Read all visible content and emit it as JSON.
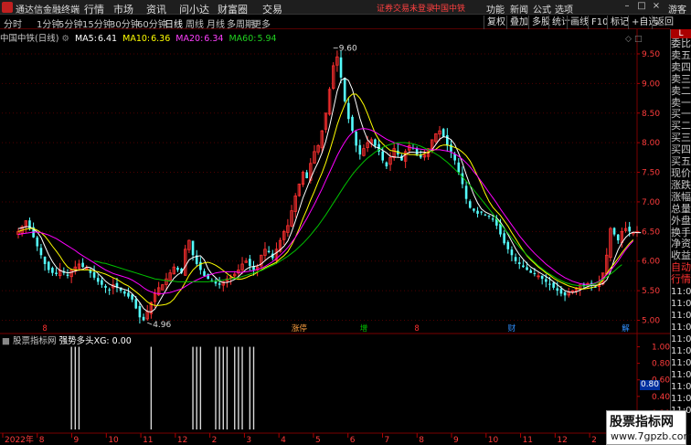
{
  "titlebar": {
    "app_title": "通达信金融终端",
    "menus": [
      "行情",
      "市场",
      "资讯",
      "问小达",
      "财富圈",
      "交易"
    ],
    "warning": "证券交易未登录",
    "stock_name": "中国中铁",
    "right_menus": [
      "功能",
      "新闻",
      "公式",
      "选项"
    ],
    "guest": "游客",
    "win_buttons": [
      "–",
      "□",
      "×"
    ]
  },
  "periods": {
    "items": [
      "分时",
      "1分钟",
      "5分钟",
      "15分钟",
      "30分钟",
      "60分钟",
      "日线",
      "周线",
      "月线",
      "多周期",
      "更多"
    ],
    "active": "日线"
  },
  "toolbar_right": [
    "复权",
    "叠加",
    "多股",
    "统计",
    "画线",
    "F10",
    "标记",
    "+自选",
    "返回"
  ],
  "main_header": {
    "stock": "中国中铁(日线)",
    "ma5_label": "MA5:",
    "ma5": "6.41",
    "ma10_label": "MA10:",
    "ma10": "6.36",
    "ma20_label": "MA20:",
    "ma20": "6.34",
    "ma60_label": "MA60:",
    "ma60": "5.94"
  },
  "colors": {
    "up": "#ff3030",
    "down": "#54fcfc",
    "ma5": "#ffffff",
    "ma10": "#ffff00",
    "ma20": "#ff00ff",
    "ma60": "#00c000",
    "grid": "#500000",
    "axis_text": "#ff3c3c"
  },
  "chart_data": [
    {
      "type": "candlestick",
      "title": "中国中铁(日线)",
      "ylim": [
        4.9,
        9.7
      ],
      "y_ticks": [
        "9.50",
        "9.00",
        "8.50",
        "8.00",
        "7.50",
        "7.00",
        "6.50",
        "6.00",
        "5.50",
        "5.00"
      ],
      "annotations": [
        {
          "label": "9.60",
          "x": 83,
          "y": 9.6
        },
        {
          "label": "4.96",
          "x": 34,
          "y": 4.96
        }
      ],
      "event_markers": [
        {
          "label": "8",
          "x": 7,
          "color": "#ff3030"
        },
        {
          "label": "涨停",
          "x": 74,
          "color": "#ffa040"
        },
        {
          "label": "增",
          "x": 91,
          "color": "#00c000"
        },
        {
          "label": "8",
          "x": 105,
          "color": "#ff3030"
        },
        {
          "label": "财",
          "x": 130,
          "color": "#3090ff"
        },
        {
          "label": "解",
          "x": 160,
          "color": "#3090ff"
        }
      ],
      "ma_last": {
        "MA5": 6.41,
        "MA10": 6.36,
        "MA20": 6.34,
        "MA60": 5.94
      },
      "series": [
        {
          "name": "close",
          "values": [
            6.5,
            6.58,
            6.68,
            6.55,
            6.4,
            6.25,
            6.1,
            5.95,
            5.85,
            5.8,
            5.78,
            5.85,
            5.8,
            5.75,
            5.85,
            5.9,
            5.95,
            5.9,
            5.88,
            5.8,
            5.72,
            5.65,
            5.6,
            5.55,
            5.52,
            5.6,
            5.55,
            5.5,
            5.45,
            5.4,
            5.35,
            5.2,
            5.05,
            5.0,
            5.15,
            5.3,
            5.45,
            5.55,
            5.6,
            5.7,
            5.8,
            5.9,
            5.85,
            5.8,
            6.2,
            6.35,
            6.1,
            5.95,
            5.85,
            5.75,
            5.7,
            5.65,
            5.62,
            5.6,
            5.65,
            5.7,
            5.72,
            5.78,
            5.85,
            5.95,
            6.0,
            5.92,
            5.85,
            5.9,
            6.1,
            6.2,
            6.15,
            6.05,
            6.2,
            6.35,
            6.5,
            6.6,
            6.85,
            7.1,
            7.3,
            7.5,
            7.4,
            7.65,
            7.85,
            7.95,
            8.2,
            8.5,
            8.9,
            9.3,
            9.45,
            9.1,
            8.7,
            8.4,
            8.2,
            7.95,
            7.8,
            7.9,
            8.0,
            8.05,
            7.95,
            7.85,
            7.7,
            7.6,
            7.75,
            7.9,
            7.8,
            7.7,
            7.85,
            7.95,
            7.9,
            7.8,
            7.75,
            7.8,
            7.9,
            8.05,
            8.15,
            8.2,
            8.1,
            7.95,
            7.85,
            7.7,
            7.5,
            7.3,
            7.05,
            6.9,
            6.85,
            6.8,
            6.82,
            6.78,
            6.75,
            6.7,
            6.6,
            6.45,
            6.3,
            6.2,
            6.1,
            6.0,
            5.95,
            5.9,
            5.85,
            5.8,
            5.78,
            5.75,
            5.7,
            5.65,
            5.6,
            5.55,
            5.5,
            5.45,
            5.42,
            5.48,
            5.5,
            5.55,
            5.6,
            5.58,
            5.62,
            5.6,
            5.55,
            5.65,
            5.8,
            6.1,
            6.55,
            6.45,
            6.35,
            6.5,
            6.55,
            6.5,
            6.48,
            6.5
          ]
        },
        {
          "name": "MA5",
          "values": [
            6.55,
            6.56,
            6.58,
            6.58,
            6.54,
            6.49,
            6.4,
            6.25,
            6.11,
            5.99,
            5.9,
            5.84,
            5.82,
            5.8,
            5.81,
            5.83,
            5.85,
            5.86,
            5.9,
            5.89,
            5.85,
            5.79,
            5.73,
            5.66,
            5.61,
            5.58,
            5.56,
            5.54,
            5.52,
            5.5,
            5.45,
            5.38,
            5.3,
            5.2,
            5.15,
            5.14,
            5.19,
            5.3,
            5.41,
            5.52,
            5.62,
            5.71,
            5.77,
            5.81,
            5.91,
            6.02,
            6.06,
            6.08,
            6.09,
            6.02,
            5.87,
            5.78,
            5.72,
            5.66,
            5.64,
            5.64,
            5.66,
            5.69,
            5.74,
            5.8,
            5.86,
            5.9,
            5.91,
            5.92,
            5.95,
            6.01,
            6.06,
            6.1,
            6.14,
            6.19,
            6.25,
            6.34,
            6.49,
            6.68,
            6.87,
            7.07,
            7.23,
            7.39,
            7.54,
            7.67,
            7.83,
            8.02,
            8.28,
            8.57,
            8.87,
            9.05,
            9.09,
            9.05,
            8.9,
            8.66,
            8.41,
            8.21,
            8.05,
            7.98,
            7.93,
            7.91,
            7.87,
            7.83,
            7.77,
            7.76,
            7.75,
            7.75,
            7.8,
            7.84,
            7.84,
            7.83,
            7.84,
            7.84,
            7.83,
            7.88,
            7.97,
            8.06,
            8.1,
            8.09,
            8.05,
            7.97,
            7.82,
            7.66,
            7.46,
            7.28,
            7.12,
            6.98,
            6.88,
            6.83,
            6.8,
            6.77,
            6.73,
            6.66,
            6.56,
            6.45,
            6.33,
            6.21,
            6.11,
            6.03,
            5.96,
            5.9,
            5.86,
            5.82,
            5.78,
            5.74,
            5.7,
            5.65,
            5.6,
            5.55,
            5.5,
            5.48,
            5.47,
            5.48,
            5.51,
            5.54,
            5.57,
            5.59,
            5.59,
            5.6,
            5.62,
            5.68,
            5.82,
            6.03,
            6.19,
            6.31,
            6.4,
            6.46,
            6.49,
            6.48,
            6.48
          ]
        },
        {
          "name": "MA10",
          "values": [
            6.5,
            6.52,
            6.54,
            6.55,
            6.55,
            6.52,
            6.48,
            6.42,
            6.34,
            6.25,
            6.17,
            6.08,
            5.98,
            5.9,
            5.86,
            5.85,
            5.85,
            5.85,
            5.85,
            5.85,
            5.83,
            5.82,
            5.8,
            5.78,
            5.75,
            5.72,
            5.69,
            5.65,
            5.61,
            5.58,
            5.53,
            5.48,
            5.43,
            5.37,
            5.31,
            5.27,
            5.25,
            5.25,
            5.26,
            5.27,
            5.3,
            5.36,
            5.45,
            5.53,
            5.64,
            5.76,
            5.85,
            5.91,
            5.95,
            5.97,
            5.98,
            5.96,
            5.93,
            5.89,
            5.84,
            5.79,
            5.74,
            5.71,
            5.69,
            5.7,
            5.72,
            5.75,
            5.77,
            5.81,
            5.85,
            5.89,
            5.92,
            5.95,
            5.98,
            6.04,
            6.09,
            6.16,
            6.27,
            6.4,
            6.55,
            6.72,
            6.87,
            7.03,
            7.18,
            7.34,
            7.49,
            7.66,
            7.86,
            8.07,
            8.3,
            8.48,
            8.64,
            8.76,
            8.82,
            8.82,
            8.75,
            8.64,
            8.49,
            8.32,
            8.16,
            8.05,
            7.98,
            7.92,
            7.87,
            7.86,
            7.84,
            7.82,
            7.81,
            7.8,
            7.8,
            7.79,
            7.79,
            7.82,
            7.84,
            7.86,
            7.89,
            7.94,
            7.96,
            7.96,
            7.94,
            7.92,
            7.89,
            7.84,
            7.78,
            7.69,
            7.57,
            7.43,
            7.29,
            7.14,
            7.01,
            6.91,
            6.84,
            6.77,
            6.68,
            6.59,
            6.48,
            6.38,
            6.28,
            6.18,
            6.09,
            6.02,
            5.96,
            5.9,
            5.85,
            5.8,
            5.76,
            5.71,
            5.67,
            5.64,
            5.61,
            5.58,
            5.56,
            5.54,
            5.53,
            5.53,
            5.54,
            5.55,
            5.57,
            5.61,
            5.68,
            5.79,
            5.88,
            5.96,
            6.05,
            6.14,
            6.22,
            6.3,
            6.36
          ]
        },
        {
          "name": "MA20",
          "values": [
            6.45,
            6.46,
            6.47,
            6.48,
            6.49,
            6.49,
            6.48,
            6.46,
            6.44,
            6.41,
            6.38,
            6.34,
            6.3,
            6.26,
            6.22,
            6.18,
            6.13,
            6.09,
            6.05,
            6.01,
            5.97,
            5.93,
            5.89,
            5.85,
            5.82,
            5.79,
            5.77,
            5.75,
            5.73,
            5.71,
            5.68,
            5.64,
            5.6,
            5.55,
            5.51,
            5.48,
            5.46,
            5.45,
            5.45,
            5.46,
            5.47,
            5.49,
            5.51,
            5.53,
            5.57,
            5.61,
            5.65,
            5.68,
            5.71,
            5.74,
            5.76,
            5.78,
            5.8,
            5.81,
            5.82,
            5.82,
            5.82,
            5.82,
            5.81,
            5.81,
            5.82,
            5.83,
            5.84,
            5.86,
            5.88,
            5.91,
            5.95,
            5.99,
            6.04,
            6.1,
            6.16,
            6.23,
            6.31,
            6.4,
            6.5,
            6.61,
            6.72,
            6.84,
            6.96,
            7.09,
            7.22,
            7.36,
            7.5,
            7.64,
            7.78,
            7.9,
            8.01,
            8.1,
            8.17,
            8.21,
            8.23,
            8.24,
            8.23,
            8.21,
            8.18,
            8.14,
            8.1,
            8.06,
            8.03,
            8.0,
            7.98,
            7.96,
            7.94,
            7.92,
            7.91,
            7.9,
            7.89,
            7.88,
            7.88,
            7.88,
            7.88,
            7.88,
            7.87,
            7.86,
            7.84,
            7.81,
            7.77,
            7.72,
            7.66,
            7.59,
            7.51,
            7.43,
            7.34,
            7.25,
            7.16,
            7.07,
            6.98,
            6.88,
            6.79,
            6.7,
            6.61,
            6.52,
            6.43,
            6.35,
            6.27,
            6.2,
            6.13,
            6.07,
            6.01,
            5.95,
            5.9,
            5.85,
            5.8,
            5.76,
            5.72,
            5.69,
            5.66,
            5.64,
            5.62,
            5.61,
            5.6,
            5.61,
            5.63,
            5.66,
            5.71,
            5.77,
            5.84,
            5.92,
            6.0,
            6.1,
            6.19,
            6.27,
            6.34
          ]
        },
        {
          "name": "MA60",
          "values": [
            null,
            null,
            null,
            null,
            null,
            null,
            null,
            null,
            null,
            null,
            null,
            null,
            null,
            null,
            null,
            null,
            null,
            null,
            null,
            null,
            6.0,
            5.99,
            5.97,
            5.96,
            5.94,
            5.92,
            5.9,
            5.88,
            5.86,
            5.84,
            5.82,
            5.8,
            5.78,
            5.76,
            5.74,
            5.72,
            5.7,
            5.69,
            5.68,
            5.67,
            5.66,
            5.66,
            5.65,
            5.65,
            5.65,
            5.65,
            5.65,
            5.65,
            5.65,
            5.65,
            5.65,
            5.66,
            5.66,
            5.67,
            5.68,
            5.69,
            5.7,
            5.71,
            5.72,
            5.74,
            5.76,
            5.78,
            5.8,
            5.82,
            5.84,
            5.87,
            5.9,
            5.93,
            5.96,
            6.0,
            6.04,
            6.08,
            6.13,
            6.18,
            6.24,
            6.3,
            6.37,
            6.44,
            6.52,
            6.6,
            6.69,
            6.78,
            6.88,
            6.98,
            7.08,
            7.18,
            7.28,
            7.37,
            7.46,
            7.54,
            7.61,
            7.68,
            7.74,
            7.79,
            7.84,
            7.88,
            7.92,
            7.95,
            7.97,
            7.99,
            8.0,
            8.0,
            8.0,
            7.99,
            7.98,
            7.96,
            7.94,
            7.91,
            7.88,
            7.85,
            7.81,
            7.77,
            7.72,
            7.67,
            7.61,
            7.55,
            7.49,
            7.42,
            7.35,
            7.28,
            7.2,
            7.12,
            7.04,
            6.96,
            6.88,
            6.8,
            6.71,
            6.63,
            6.55,
            6.47,
            6.39,
            6.31,
            6.24,
            6.17,
            6.1,
            6.04,
            5.98,
            5.92,
            5.87,
            5.82,
            5.78,
            5.74,
            5.7,
            5.67,
            5.64,
            5.62,
            5.6,
            5.59,
            5.58,
            5.58,
            5.59,
            5.6,
            5.62,
            5.65,
            5.69,
            5.73,
            5.78,
            5.83,
            5.89,
            5.94
          ]
        }
      ]
    },
    {
      "type": "bar",
      "title": "强势多头XG: 0.00",
      "ylim": [
        0,
        1.05
      ],
      "y_ticks": [
        "1.00",
        "0.80",
        "0.60",
        "0.40",
        "0.20"
      ],
      "signal_x": [
        14,
        15,
        16,
        35,
        46,
        47,
        48,
        52,
        53,
        54,
        55,
        57,
        58,
        59,
        61,
        62
      ],
      "signal_values": [
        1,
        1,
        1,
        1,
        1,
        1,
        1,
        1,
        1,
        1,
        1,
        1,
        1,
        1,
        1,
        1
      ]
    }
  ],
  "indicator_header": {
    "name": "股票指标网",
    "label": "强势多头XG:",
    "value": "0.00",
    "highlight_value": "0.80"
  },
  "month_axis": [
    "2022年",
    "8",
    "9",
    "10",
    "11",
    "12",
    "2",
    "3",
    "4",
    "5",
    "6",
    "7",
    "8",
    "9",
    "10",
    "11",
    "12",
    "2",
    "3"
  ],
  "side_panel": {
    "top_label": "L",
    "items": [
      "委比",
      "卖五",
      "卖四",
      "卖三",
      "卖二",
      "卖一",
      "买一",
      "买二",
      "买三",
      "买四",
      "买五",
      "现价",
      "涨跌",
      "涨幅",
      "总量",
      "外盘",
      "换手",
      "净资",
      "收益",
      "自动",
      "行情"
    ],
    "times": [
      "11:0",
      "11:0",
      "11:0",
      "11:0",
      "11:0",
      "11:0",
      "11:0",
      "11:0",
      "11:0",
      "11:0",
      "11:0"
    ]
  },
  "watermark": {
    "line1": "股票指标网",
    "line2": "www.7gpzb.com"
  }
}
